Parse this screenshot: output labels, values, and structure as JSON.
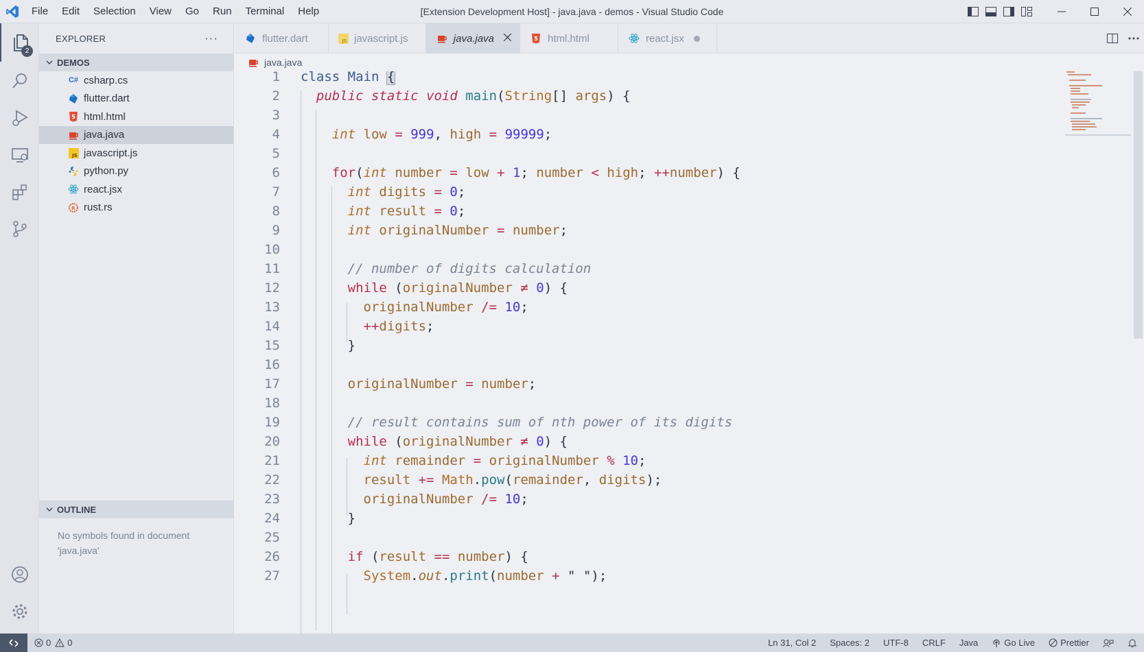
{
  "window": {
    "title": "[Extension Development Host] - java.java - demos - Visual Studio Code",
    "menu": [
      "File",
      "Edit",
      "Selection",
      "View",
      "Go",
      "Run",
      "Terminal",
      "Help"
    ]
  },
  "activity": {
    "explorer_badge": "2"
  },
  "sidebar": {
    "title": "EXPLORER",
    "more": "···",
    "folder": "DEMOS",
    "files": [
      {
        "name": "csharp.cs",
        "icon": "csharp-icon"
      },
      {
        "name": "flutter.dart",
        "icon": "dart-icon"
      },
      {
        "name": "html.html",
        "icon": "html5-icon"
      },
      {
        "name": "java.java",
        "icon": "java-icon",
        "selected": true
      },
      {
        "name": "javascript.js",
        "icon": "javascript-icon"
      },
      {
        "name": "python.py",
        "icon": "python-icon"
      },
      {
        "name": "react.jsx",
        "icon": "react-icon"
      },
      {
        "name": "rust.rs",
        "icon": "rust-icon"
      }
    ],
    "outline_title": "OUTLINE",
    "outline_message": "No symbols found in document 'java.java'"
  },
  "tabs": [
    {
      "label": "flutter.dart",
      "icon": "dart-icon",
      "state": "none"
    },
    {
      "label": "javascript.js",
      "icon": "javascript-icon",
      "state": "dirty"
    },
    {
      "label": "java.java",
      "icon": "java-icon",
      "state": "active"
    },
    {
      "label": "html.html",
      "icon": "html5-icon",
      "state": "none"
    },
    {
      "label": "react.jsx",
      "icon": "react-icon",
      "state": "dirty"
    }
  ],
  "breadcrumb": "java.java",
  "code_lines": [
    "class Main {",
    "  public static void main(String[] args) {",
    "",
    "    int low = 999, high = 99999;",
    "",
    "    for(int number = low + 1; number < high; ++number) {",
    "      int digits = 0;",
    "      int result = 0;",
    "      int originalNumber = number;",
    "",
    "      // number of digits calculation",
    "      while (originalNumber ≠ 0) {",
    "        originalNumber /= 10;",
    "        ++digits;",
    "      }",
    "",
    "      originalNumber = number;",
    "",
    "      // result contains sum of nth power of its digits",
    "      while (originalNumber ≠ 0) {",
    "        int remainder = originalNumber % 10;",
    "        result += Math.pow(remainder, digits);",
    "        originalNumber /= 10;",
    "      }",
    "",
    "      if (result == number) {",
    "        System.out.print(number + \" \");"
  ],
  "status": {
    "errors": "0",
    "warnings": "0",
    "position": "Ln 31, Col 2",
    "spaces": "Spaces: 2",
    "encoding": "UTF-8",
    "eol": "CRLF",
    "language": "Java",
    "go_live": "Go Live",
    "prettier": "Prettier"
  },
  "colors": {
    "keyword": "#b5304b",
    "type": "#ad6f2b",
    "number": "#4935d6",
    "comment": "#7b8394",
    "function": "#2a7a87"
  }
}
